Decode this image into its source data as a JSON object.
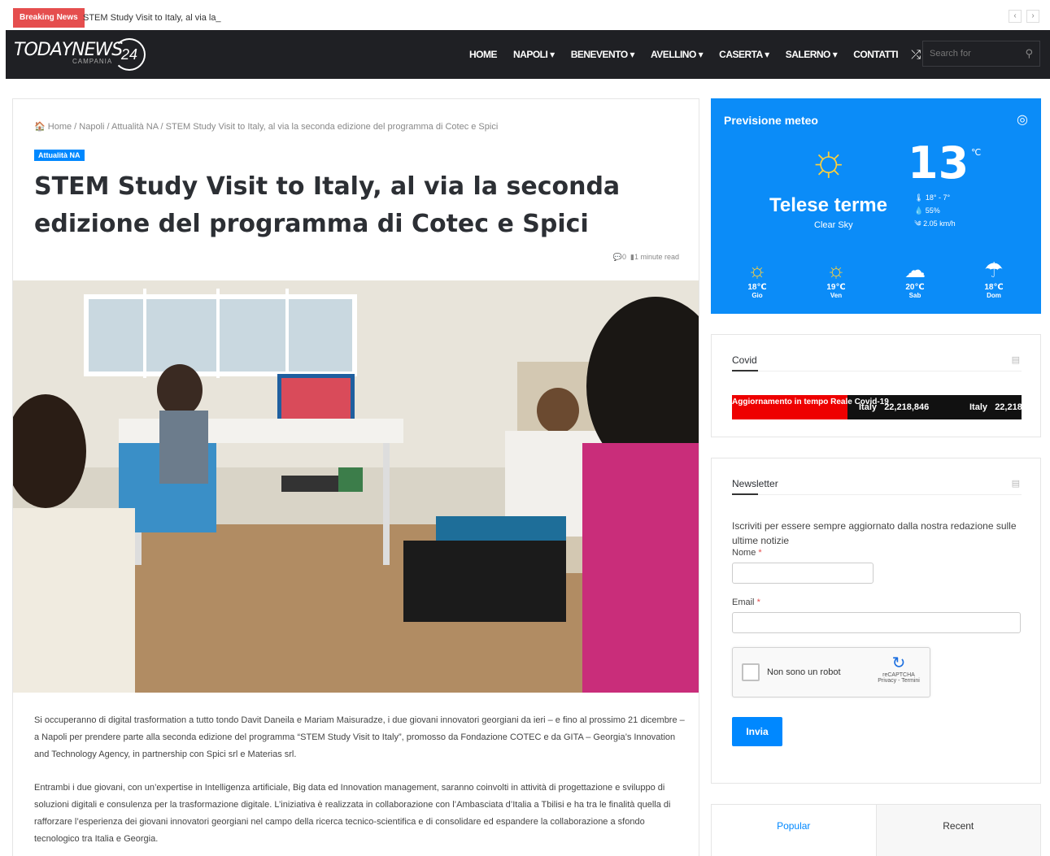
{
  "breaking": {
    "label": "Breaking News",
    "text": "STEM Study Visit to Italy, al via la_",
    "prev": "‹",
    "next": "›"
  },
  "header": {
    "logo_main": "TODAYNEWS",
    "logo_sub": "CAMPANIA",
    "logo_num": "24",
    "nav": [
      "HOME",
      "NAPOLI ▾",
      "BENEVENTO ▾",
      "AVELLINO ▾",
      "CASERTA ▾",
      "SALERNO ▾",
      "CONTATTI"
    ],
    "search_placeholder": "Search for"
  },
  "article": {
    "breadcrumb": "🏠 Home / Napoli / Attualità NA / STEM Study Visit to Italy, al via la seconda edizione del programma di Cotec e Spici",
    "category": "Attualità NA",
    "title": "STEM Study Visit to Italy, al via la seconda edizione del programma di Cotec e Spici",
    "comments": "0",
    "read_time": "1 minute read",
    "p1": "Si occuperanno di digital trasformation a tutto tondo Davit Daneila e Mariam Maisuradze, i due giovani innovatori georgiani da ieri – e fino al prossimo 21 dicembre – a Napoli per prendere parte alla seconda edizione del programma “STEM Study Visit to Italy”, promosso da Fondazione COTEC e da GITA – Georgia’s Innovation and Technology Agency, in partnership con Spici srl e Materias srl.",
    "p2": "Entrambi i due giovani, con un’expertise in Intelligenza artificiale, Big data ed Innovation management, saranno coinvolti in attività di progettazione e sviluppo di soluzioni digitali e consulenza per la trasformazione digitale. L’iniziativa è realizzata in collaborazione con l’Ambasciata d’Italia a Tbilisi e ha tra le finalità quella di rafforzare l’esperienza dei giovani innovatori georgiani nel campo della ricerca tecnico-scientifica e di consolidare ed espandere la collaborazione a sfondo tecnologico tra Italia e Georgia."
  },
  "weather": {
    "title": "Previsione meteo",
    "temp": "13",
    "unit": "℃",
    "city": "Telese terme",
    "desc": "Clear Sky",
    "range": "🌡 18° - 7°",
    "humidity": "💧 55%",
    "wind": "༄ 2.05 km/h",
    "days": [
      {
        "icon": "☼",
        "temp": "18℃",
        "day": "Gio"
      },
      {
        "icon": "☼",
        "temp": "19℃",
        "day": "Ven"
      },
      {
        "icon": "☁",
        "temp": "20℃",
        "day": "Sab"
      },
      {
        "icon": "☂",
        "temp": "18℃",
        "day": "Dom"
      }
    ]
  },
  "covid": {
    "title": "Covid",
    "label": "Aggiornamento in tempo Reale Covid-19",
    "country": "Italy",
    "count": "22,218,846",
    "country2": "Italy",
    "count2": "22,218"
  },
  "newsletter": {
    "title": "Newsletter",
    "desc": "Iscriviti per essere sempre aggiornato dalla nostra redazione sulle ultime notizie",
    "name_label": "Nome",
    "email_label": "Email",
    "required": "*",
    "captcha_text": "Non sono un robot",
    "captcha_brand": "reCAPTCHA",
    "captcha_links": "Privacy - Termini",
    "submit": "Invia"
  },
  "tabs": [
    "Popular",
    "Recent"
  ]
}
